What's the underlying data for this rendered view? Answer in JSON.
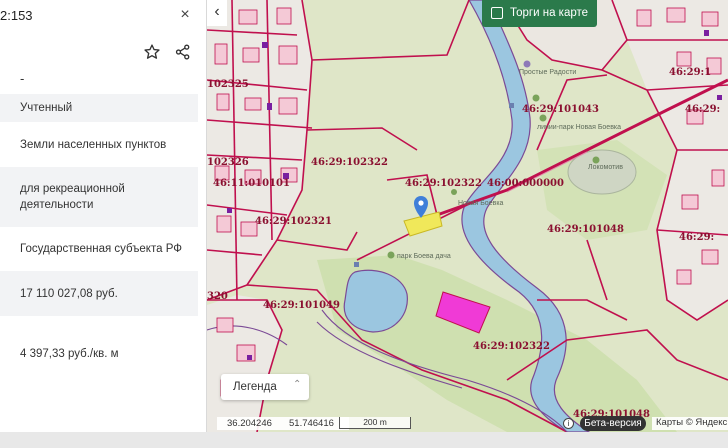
{
  "panel": {
    "cad_number": "2:153",
    "close_label": "×",
    "dash": "-",
    "fields": {
      "status": "Учтенный",
      "category": "Земли населенных пунктов",
      "permitted_use": "для рекреационной деятельности",
      "ownership": "Государственная субъекта РФ",
      "cadastral_value": "17 110 027,08 руб.",
      "specific_value": "4 397,33 руб./кв. м"
    }
  },
  "map": {
    "back_label": "‹",
    "torgi_label": "Торги на карте",
    "cad_labels": {
      "l1": "46:29:101043",
      "l2": "102325",
      "l3": "46:29:102322",
      "l4": "102326",
      "l5": "46:29:102322",
      "l6": "46:00:000000",
      "l7": "46:11:010101",
      "l8": "46:29:102321",
      "l9": "46:29:101048",
      "l10": "46:29:101049",
      "l11": "320",
      "l12": "46:29:102322",
      "l13": "46:29:101048",
      "l14": "46:29:1",
      "l15": "46:29:",
      "l16": "46:29:"
    },
    "places": {
      "radosti": "Простые Радости",
      "park_label": "линии-парк Новая Боевка",
      "lokomotiv": "Локомотив",
      "novaya": "Новая Боевка",
      "park_boev": "парк Боева дача"
    },
    "legend_label": "Легенда",
    "legend_chevron": "⌃",
    "coords": {
      "lon": "36.204246",
      "lat": "51.746416"
    },
    "scale_label": "200 m",
    "info_icon": "i",
    "beta_label": "Бета-версия",
    "copyright": "Карты © Яндекс"
  },
  "colors": {
    "river": "#9bc6e0",
    "boundary": "#c0104e",
    "selected_parcel": "#f0e85a",
    "highlight_parcel": "#f03ad6",
    "marker": "#3f7fd9",
    "torgi_green": "#2b7a4b"
  }
}
